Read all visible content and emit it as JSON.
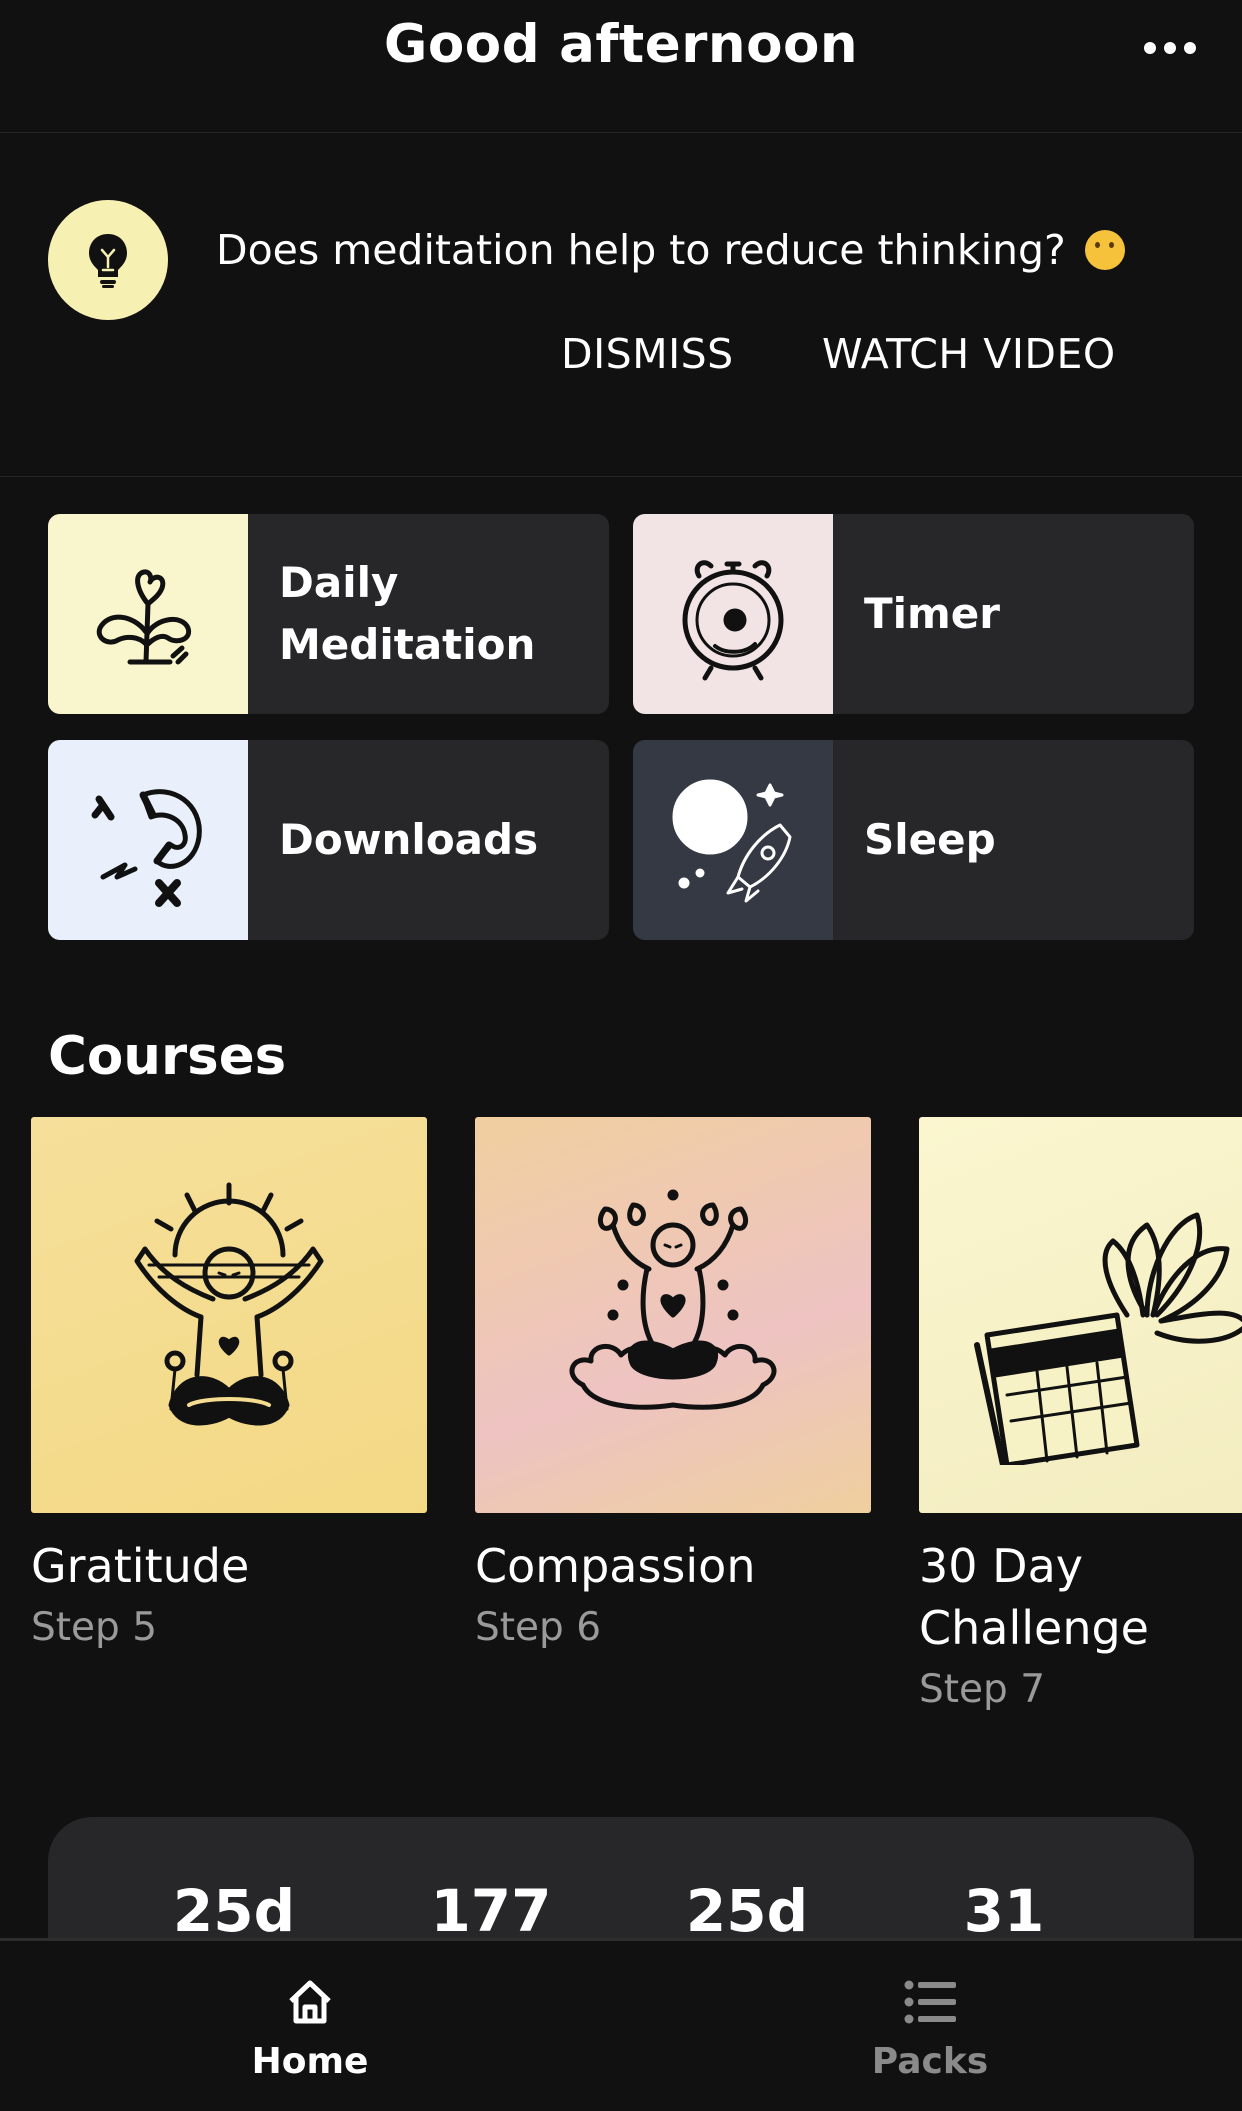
{
  "header": {
    "title": "Good afternoon"
  },
  "tip": {
    "question": "Does meditation help to reduce thinking?",
    "dismiss_label": "DISMISS",
    "watch_label": "WATCH VIDEO"
  },
  "tiles": [
    {
      "label": "Daily\nMeditation",
      "thumb_color": "#f9f5cc"
    },
    {
      "label": "Timer",
      "thumb_color": "#f2e4e4"
    },
    {
      "label": "Downloads",
      "thumb_color": "#e9f0fb"
    },
    {
      "label": "Sleep",
      "thumb_color": "#343944"
    }
  ],
  "courses": {
    "title": "Courses",
    "items": [
      {
        "title": "Gratitude",
        "step": "Step 5"
      },
      {
        "title": "Compassion",
        "step": "Step 6"
      },
      {
        "title": "30 Day Challenge",
        "step": "Step 7"
      }
    ]
  },
  "stats": [
    "25d",
    "177",
    "25d",
    "31"
  ],
  "nav": {
    "home_label": "Home",
    "packs_label": "Packs"
  },
  "colors": {
    "background": "#111111",
    "card": "#27272a",
    "tip_icon_bg": "#f7f0b3",
    "muted_text": "#9a9a9a"
  }
}
